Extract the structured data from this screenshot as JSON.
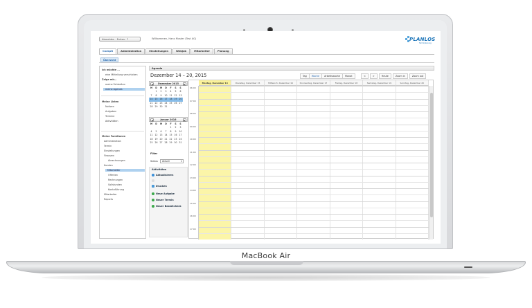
{
  "device": {
    "brand": "MacBook Air"
  },
  "app": {
    "user_combo": "Abmelden · Extras · ?",
    "welcome": "Willkommen, Hans Muster (Test AG)",
    "logo_text": "PLANLOS",
    "logo_sub": "Terminplanung"
  },
  "tabs": [
    "Cockpit",
    "Administration",
    "Einstellungen",
    "Webjob",
    "Mitarbeiter",
    "Planung"
  ],
  "subtab": "Übersicht",
  "nav": {
    "sections": [
      {
        "label": "Ich möchte ...",
        "items": [
          "eine Mitteilung verschicken"
        ]
      },
      {
        "label": "Zeige mir...",
        "items": [
          "meine Fehlzeiten",
          "meine Agenda"
        ]
      },
      {
        "label": "Meine Listen",
        "items": [
          "Notizen",
          "Aufgaben",
          "Termine",
          "Aktivitäten"
        ]
      },
      {
        "label": "Meine Funktionen",
        "items": [
          "Administration",
          "Termin",
          "Einstellungen",
          "Finanzen",
          "Abrechnungen",
          "Kunden",
          "Mitarbeiter",
          "Offerten",
          "Rechnungen",
          "Sollstunden",
          "Kontoführung",
          "Mitarbeiter",
          "Reports"
        ]
      }
    ],
    "selected": "meine Agenda"
  },
  "mini_cal_1": {
    "title": "Dezember 2015",
    "weekdays": [
      "M",
      "D",
      "M",
      "D",
      "F",
      "S",
      "S"
    ],
    "days": [
      "",
      "1",
      "2",
      "3",
      "4",
      "5",
      "6",
      "7",
      "8",
      "9",
      "10",
      "11",
      "12",
      "13",
      "14",
      "15",
      "16",
      "17",
      "18",
      "19",
      "20",
      "21",
      "22",
      "23",
      "24",
      "25",
      "26",
      "27",
      "28",
      "29",
      "30",
      "31",
      "",
      ""
    ]
  },
  "mini_cal_2": {
    "title": "Januar 2016",
    "weekdays": [
      "M",
      "D",
      "M",
      "D",
      "F",
      "S",
      "S"
    ],
    "days": [
      "",
      "",
      "",
      "",
      "1",
      "2",
      "3",
      "4",
      "5",
      "6",
      "7",
      "8",
      "9",
      "10",
      "11",
      "12",
      "13",
      "14",
      "15",
      "16",
      "17",
      "18",
      "19",
      "20",
      "21",
      "22",
      "23",
      "24",
      "25",
      "26",
      "27",
      "28",
      "29",
      "30",
      "31"
    ]
  },
  "filter": {
    "label": "Filter",
    "status_label": "Status",
    "status_value": "Aktuell"
  },
  "actions": {
    "label": "Aktivitäten",
    "items": [
      {
        "label": "Aktualisieren",
        "color": "#3a8fd8"
      },
      {
        "label": "Drucken",
        "color": "#4a9ad8"
      },
      {
        "label": "Neue Aufgabe",
        "color": "#3aa84a"
      },
      {
        "label": "Neuer Termin",
        "color": "#3aa84a"
      },
      {
        "label": "Neuer Basketcheck",
        "color": "#3aa84a"
      }
    ]
  },
  "agenda": {
    "header": "Agenda",
    "range": "Dezember 14 – 20, 2015",
    "views": [
      "Tag",
      "Woche",
      "Arbeitswoche",
      "Monat"
    ],
    "active_view": "Woche",
    "nav": [
      "<",
      ">",
      "Heute",
      "Zoom in",
      "Zoom out"
    ],
    "days": [
      "Montag, Dezember 14",
      "Dienstag, Dezember 15",
      "Mittwoch, Dezember 16",
      "Donnerstag, Dezember 17",
      "Freitag, Dezember 18",
      "Samstag, Dezember 19",
      "Sonntag, Dezember 20"
    ],
    "times": [
      "06:00",
      "07:00",
      "08:00",
      "09:00",
      "10:00",
      "11:00",
      "12:00",
      "13:00",
      "14:00",
      "15:00",
      "16:00",
      "17:00"
    ]
  }
}
